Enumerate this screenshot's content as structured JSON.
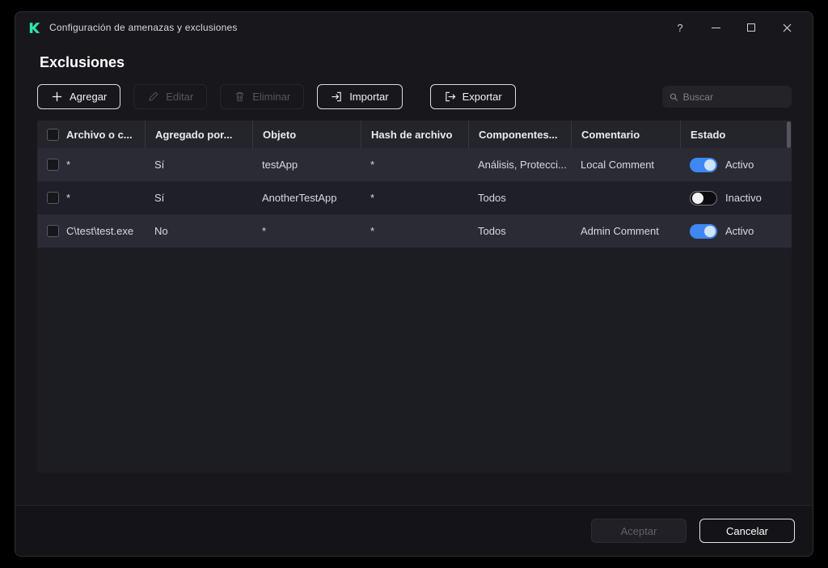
{
  "window": {
    "title": "Configuración de amenazas y exclusiones",
    "controls": {
      "help": "?"
    }
  },
  "page": {
    "title": "Exclusiones"
  },
  "toolbar": {
    "add": "Agregar",
    "edit": "Editar",
    "delete": "Eliminar",
    "import": "Importar",
    "export": "Exportar",
    "search_placeholder": "Buscar"
  },
  "table": {
    "columns": [
      "Archivo o c...",
      "Agregado por...",
      "Objeto",
      "Hash de archivo",
      "Componentes...",
      "Comentario",
      "Estado"
    ],
    "rows": [
      {
        "file": "*",
        "added_by": "Sí",
        "object": "testApp",
        "hash": "*",
        "components": "Análisis, Protecci...",
        "comment": "Local Comment",
        "state": "Activo",
        "active": true
      },
      {
        "file": "*",
        "added_by": "Sí",
        "object": "AnotherTestApp",
        "hash": "*",
        "components": "Todos",
        "comment": "",
        "state": "Inactivo",
        "active": false
      },
      {
        "file": "C\\test\\test.exe",
        "added_by": "No",
        "object": "*",
        "hash": "*",
        "components": "Todos",
        "comment": "Admin Comment",
        "state": "Activo",
        "active": true
      }
    ]
  },
  "footer": {
    "accept": "Aceptar",
    "cancel": "Cancelar"
  },
  "colors": {
    "accent_green": "#2ee6a8",
    "toggle_on": "#3f87f2"
  }
}
